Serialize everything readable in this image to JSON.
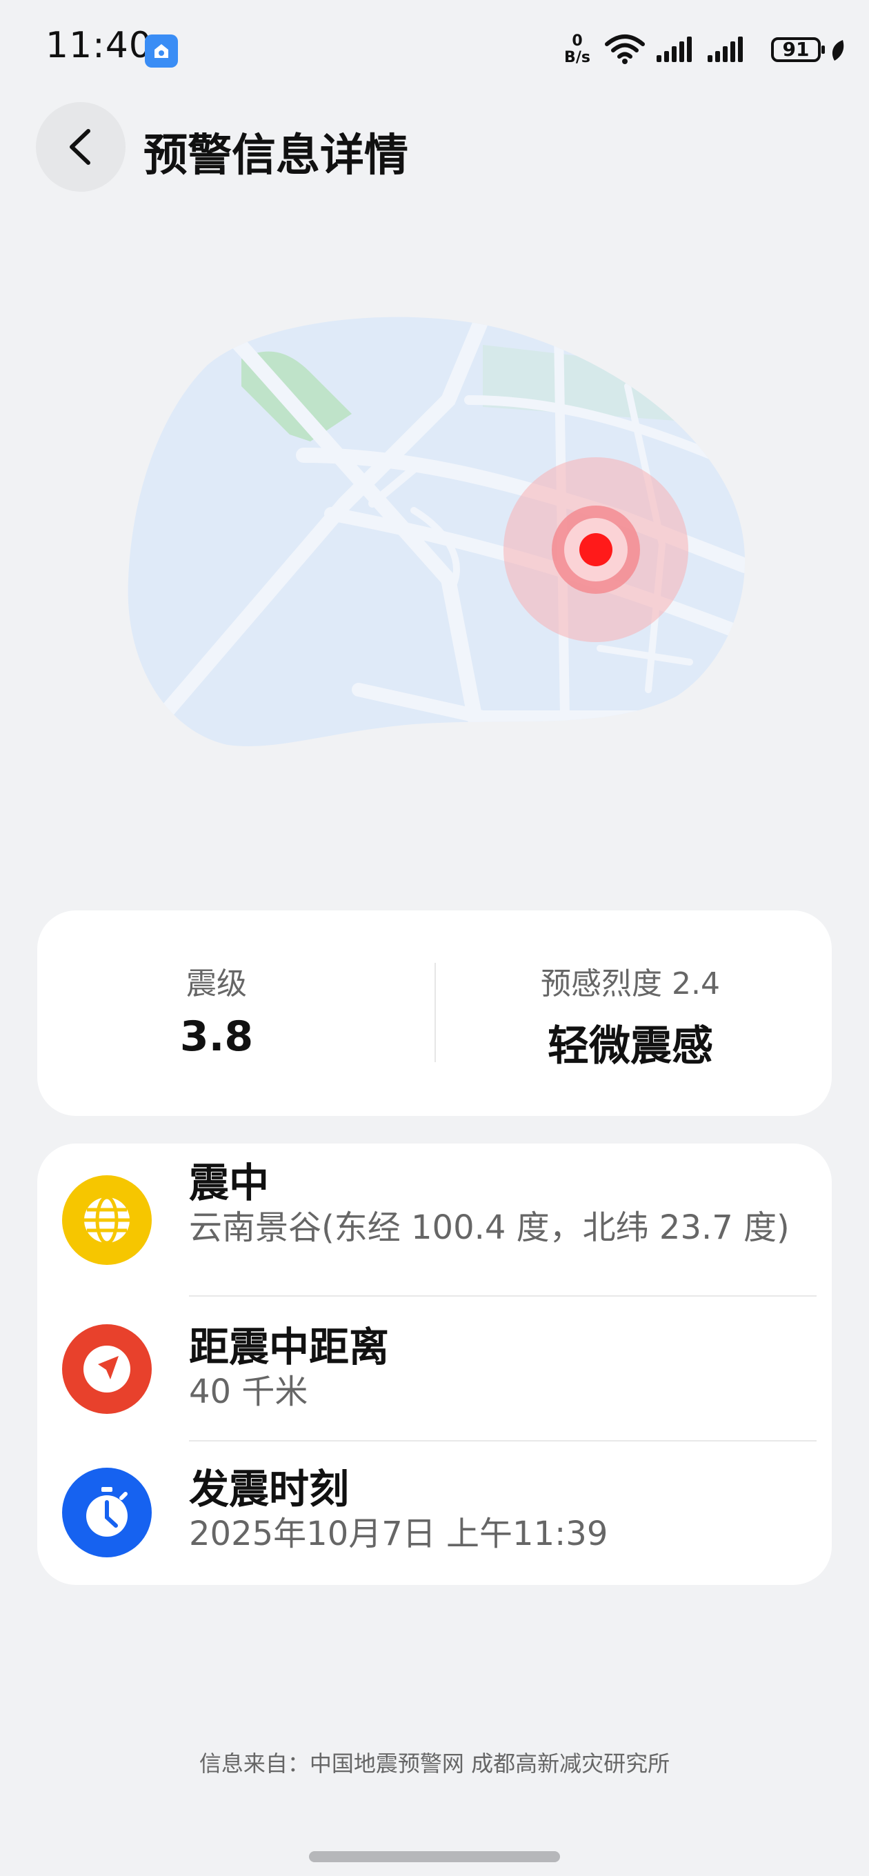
{
  "status_bar": {
    "time": "11:40",
    "net_speed_value": "0",
    "net_speed_unit": "B/s",
    "battery": "91"
  },
  "header": {
    "title": "预警信息详情"
  },
  "colors": {
    "epicenter_icon": "#f6c600",
    "distance_icon": "#e8412c",
    "time_icon": "#1662f0",
    "epicenter_dot": "#ff1a1a"
  },
  "magnitude_card": {
    "magnitude_label": "震级",
    "magnitude_value": "3.8",
    "intensity_label": "预感烈度 2.4",
    "intensity_value": "轻微震感"
  },
  "info": {
    "epicenter": {
      "icon": "globe-icon",
      "title": "震中",
      "text": "云南景谷(东经 100.4 度，北纬 23.7 度)"
    },
    "distance": {
      "icon": "navigation-arrow-icon",
      "title": "距震中距离",
      "text": "40 千米"
    },
    "time": {
      "icon": "stopwatch-icon",
      "title": "发震时刻",
      "text": "2025年10月7日 上午11:39"
    }
  },
  "footer": {
    "source": "信息来自：中国地震预警网 成都高新减灾研究所"
  }
}
